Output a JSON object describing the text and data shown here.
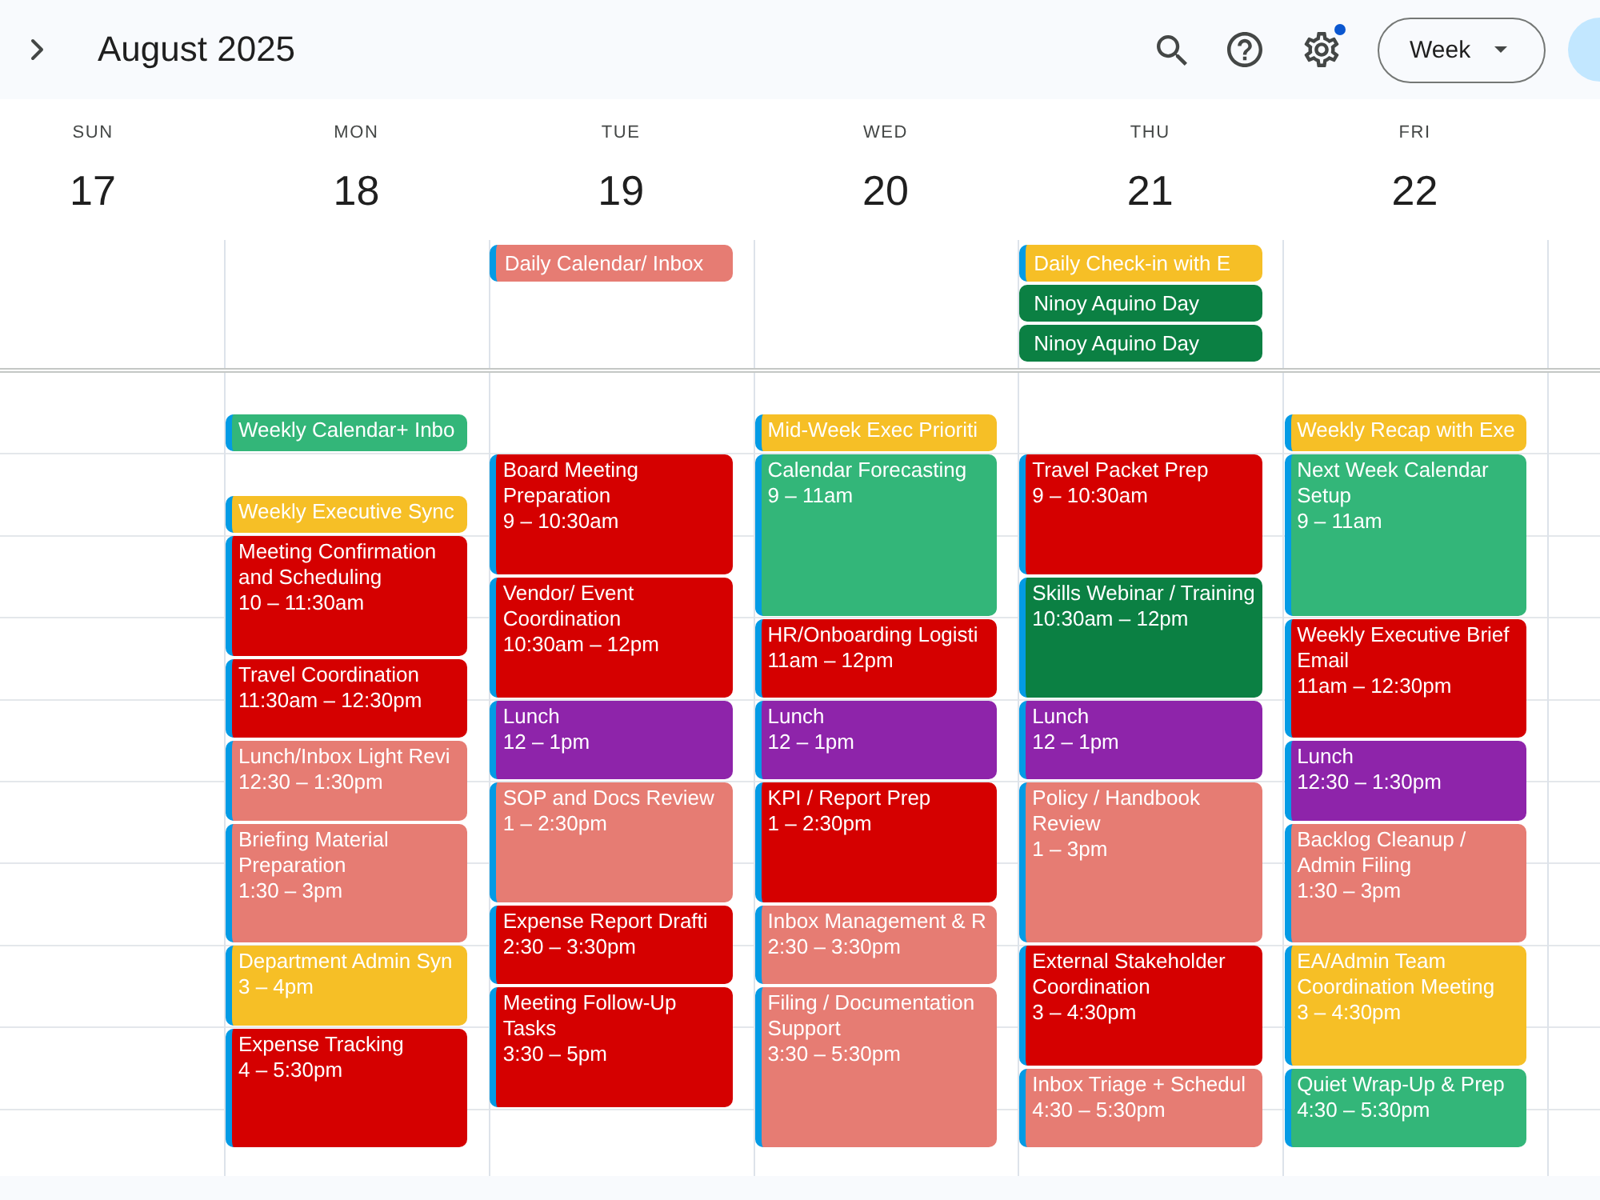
{
  "header": {
    "title": "August 2025",
    "settings": {
      "badge": true
    },
    "view_menu": {
      "label": "Week"
    }
  },
  "days": [
    {
      "name": "SUN",
      "date": "17"
    },
    {
      "name": "MON",
      "date": "18",
      "events": [
        {
          "title": "Weekly Calendar+ Inbo",
          "color": "#33b679",
          "stripe": true
        },
        {
          "title": "Weekly Executive Sync",
          "color": "#f6bf26",
          "stripe": true
        },
        {
          "title": "Meeting Confirmation and Scheduling",
          "time": "10 – 11:30am",
          "color": "#d50000",
          "stripe": true
        },
        {
          "title": "Travel Coordination",
          "time": "11:30am – 12:30pm",
          "color": "#d50000",
          "stripe": true
        },
        {
          "title": "Lunch/Inbox Light Revi",
          "time": "12:30 – 1:30pm",
          "color": "#e67c73",
          "stripe": true
        },
        {
          "title": "Briefing Material Preparation",
          "time": "1:30 – 3pm",
          "color": "#e67c73",
          "stripe": true
        },
        {
          "title": "Department Admin Syn",
          "time": "3 – 4pm",
          "color": "#f6bf26",
          "stripe": true
        },
        {
          "title": "Expense Tracking",
          "time": "4 – 5:30pm",
          "color": "#d50000",
          "stripe": true
        }
      ]
    },
    {
      "name": "TUE",
      "date": "19",
      "all_day": [
        {
          "title": "Daily Calendar/ Inbox",
          "color": "#e67c73",
          "stripe": true
        }
      ],
      "events": [
        {
          "title": "Board Meeting Preparation",
          "time": "9 – 10:30am",
          "color": "#d50000",
          "stripe": true
        },
        {
          "title": "Vendor/ Event Coordination",
          "time": "10:30am – 12pm",
          "color": "#d50000",
          "stripe": true
        },
        {
          "title": "Lunch",
          "time": "12 – 1pm",
          "color": "#8e24aa",
          "stripe": true
        },
        {
          "title": "SOP and Docs Review",
          "time": "1 – 2:30pm",
          "color": "#e67c73",
          "stripe": true
        },
        {
          "title": "Expense Report Drafti",
          "time": "2:30 – 3:30pm",
          "color": "#d50000",
          "stripe": true
        },
        {
          "title": "Meeting Follow-Up Tasks",
          "time": "3:30 – 5pm",
          "color": "#d50000",
          "stripe": true
        }
      ]
    },
    {
      "name": "WED",
      "date": "20",
      "events": [
        {
          "title": "Mid-Week Exec Prioriti",
          "color": "#f6bf26",
          "stripe": true
        },
        {
          "title": "Calendar Forecasting",
          "time": "9 – 11am",
          "color": "#33b679",
          "stripe": true
        },
        {
          "title": "HR/Onboarding Logisti",
          "time": "11am – 12pm",
          "color": "#d50000",
          "stripe": true
        },
        {
          "title": "Lunch",
          "time": "12 – 1pm",
          "color": "#8e24aa",
          "stripe": true
        },
        {
          "title": "KPI / Report Prep",
          "time": "1 – 2:30pm",
          "color": "#d50000",
          "stripe": true
        },
        {
          "title": "Inbox Management & R",
          "time": "2:30 – 3:30pm",
          "color": "#e67c73",
          "stripe": true
        },
        {
          "title": "Filing / Documentation Support",
          "time": "3:30 – 5:30pm",
          "color": "#e67c73",
          "stripe": true
        }
      ]
    },
    {
      "name": "THU",
      "date": "21",
      "all_day": [
        {
          "title": "Daily Check-in with E",
          "color": "#f6bf26",
          "stripe": true
        },
        {
          "title": "Ninoy Aquino Day",
          "color": "#0b8043",
          "stripe": false
        },
        {
          "title": "Ninoy Aquino Day",
          "color": "#0b8043",
          "stripe": false
        }
      ],
      "events": [
        {
          "title": "Travel Packet Prep",
          "time": "9 – 10:30am",
          "color": "#d50000",
          "stripe": true
        },
        {
          "title": "Skills Webinar / Training",
          "time": "10:30am – 12pm",
          "color": "#0b8043",
          "stripe": true
        },
        {
          "title": "Lunch",
          "time": "12 – 1pm",
          "color": "#8e24aa",
          "stripe": true
        },
        {
          "title": "Policy / Handbook Review",
          "time": "1 – 3pm",
          "color": "#e67c73",
          "stripe": true
        },
        {
          "title": "External Stakeholder Coordination",
          "time": "3 – 4:30pm",
          "color": "#d50000",
          "stripe": true
        },
        {
          "title": "Inbox Triage + Schedul",
          "time": "4:30 – 5:30pm",
          "color": "#e67c73",
          "stripe": true
        }
      ]
    },
    {
      "name": "FRI",
      "date": "22",
      "events": [
        {
          "title": "Weekly Recap with Exe",
          "color": "#f6bf26",
          "stripe": true
        },
        {
          "title": "Next Week Calendar Setup",
          "time": "9 – 11am",
          "color": "#33b679",
          "stripe": true
        },
        {
          "title": "Weekly Executive Brief Email",
          "time": "11am – 12:30pm",
          "color": "#d50000",
          "stripe": true
        },
        {
          "title": "Lunch",
          "time": "12:30 – 1:30pm",
          "color": "#8e24aa",
          "stripe": true
        },
        {
          "title": "Backlog Cleanup / Admin Filing",
          "time": "1:30 – 3pm",
          "color": "#e67c73",
          "stripe": true
        },
        {
          "title": "EA/Admin Team Coordination Meeting",
          "time": "3 – 4:30pm",
          "color": "#f6bf26",
          "stripe": true
        },
        {
          "title": "Quiet Wrap-Up & Prep",
          "time": "4:30 – 5:30pm",
          "color": "#33b679",
          "stripe": true
        }
      ]
    }
  ]
}
